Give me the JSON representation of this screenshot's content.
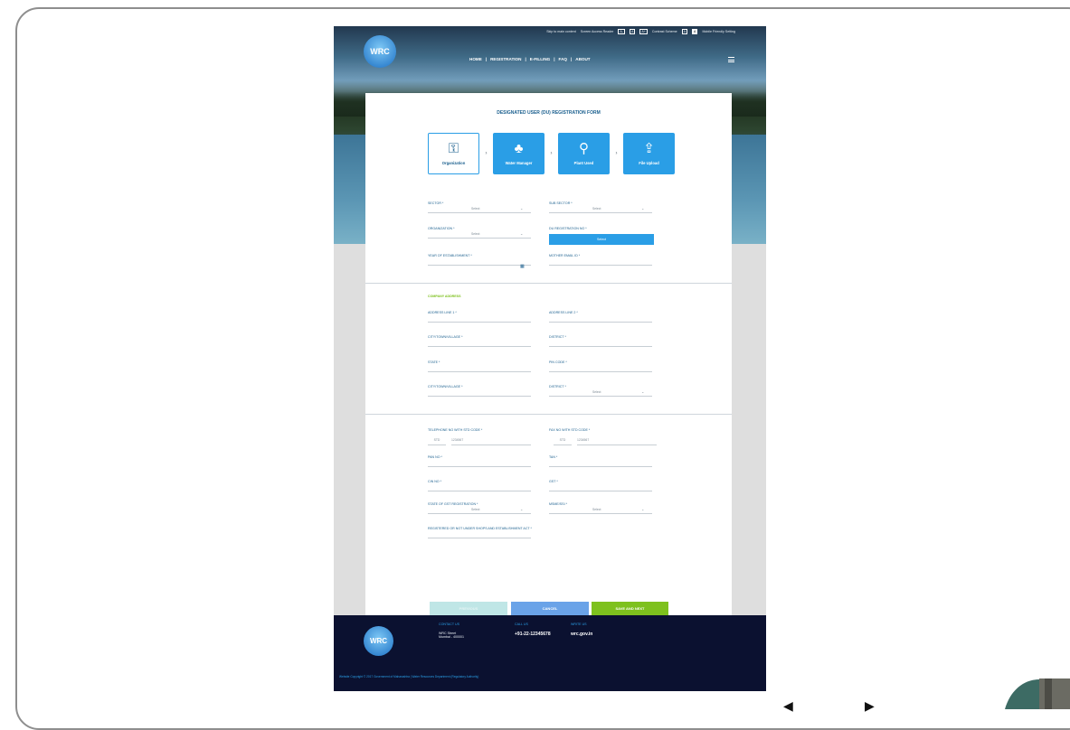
{
  "header": {
    "logo_text": "WRC",
    "top_links": [
      "Skip to main content",
      "Screen Access Reader",
      "A-",
      "A",
      "A+",
      "Contrast Scheme",
      "A",
      "A",
      "Mobile Friendly Setting"
    ],
    "nav": [
      "HOME",
      "|",
      "REGISTRATION",
      "|",
      "E-FILLING",
      "|",
      "FAQ",
      "|",
      "ABOUT"
    ]
  },
  "form": {
    "title": "DESIGNATED USER (DU) REGISTRATION FORM",
    "steps": [
      {
        "label": "Organization",
        "icon": "⚿"
      },
      {
        "label": "Water Manager",
        "icon": "♣"
      },
      {
        "label": "Plant Used",
        "icon": "⚲"
      },
      {
        "label": "File Upload",
        "icon": "⇪"
      }
    ],
    "step_arrow": "›",
    "fields": {
      "sector": "SECTOR *",
      "sub_sector": "SUB SECTOR *",
      "select": "Select",
      "organization": "ORGANIZATION *",
      "du_registration_no": "DU REGISTRATION NO *",
      "year_of_establishment": "YEAR OF ESTABLISHMENT *",
      "mother_email": "MOTHER EMAIL ID *"
    },
    "du_button": "Select",
    "address": {
      "section_title": "COMPANY ADDRESS",
      "line1": "ADDRESS LINE 1 *",
      "line2": "ADDRESS LINE 2 *",
      "city": "CITY/TOWN/VILLAGE *",
      "district": "DISTRICT *",
      "state": "STATE *",
      "pin": "PIN CODE *",
      "city2": "CITY/TOWN/VILLAGE *",
      "district2": "DISTRICT *"
    },
    "contact": {
      "telephone": "TELEPHONE NO WITH STD CODE *",
      "fax": "FAX NO WITH STD CODE *",
      "std": "STD",
      "number": "1234567",
      "std2": "STD",
      "number2": "1234567",
      "pan": "PAN NO *",
      "tan": "TAN *",
      "cin": "CIN NO *",
      "gst": "GST *",
      "state_reg": "STATE OF GST REGISTRATION *",
      "msme": "MSME/SSI *",
      "legal": "REGISTERED OR NOT UNDER SHOPS AND ESTABLISHMENT ACT *"
    },
    "buttons": {
      "prev": "PREVIOUS",
      "cancel": "CANCEL",
      "save": "SAVE AND NEXT"
    }
  },
  "footer": {
    "logo_text": "WRC",
    "contact_heading": "CONTACT US",
    "contact_lines": [
      "WRC Street",
      "Mumbai - 400001"
    ],
    "call_heading": "CALL US",
    "phone": "+91-22-12345678",
    "write_heading": "WRITE US",
    "website": "wrc.gov.in",
    "copyright": "Website Copyright © 2017 Government of Maharashtra | Water Resources Department (Regulatory Authority)"
  }
}
